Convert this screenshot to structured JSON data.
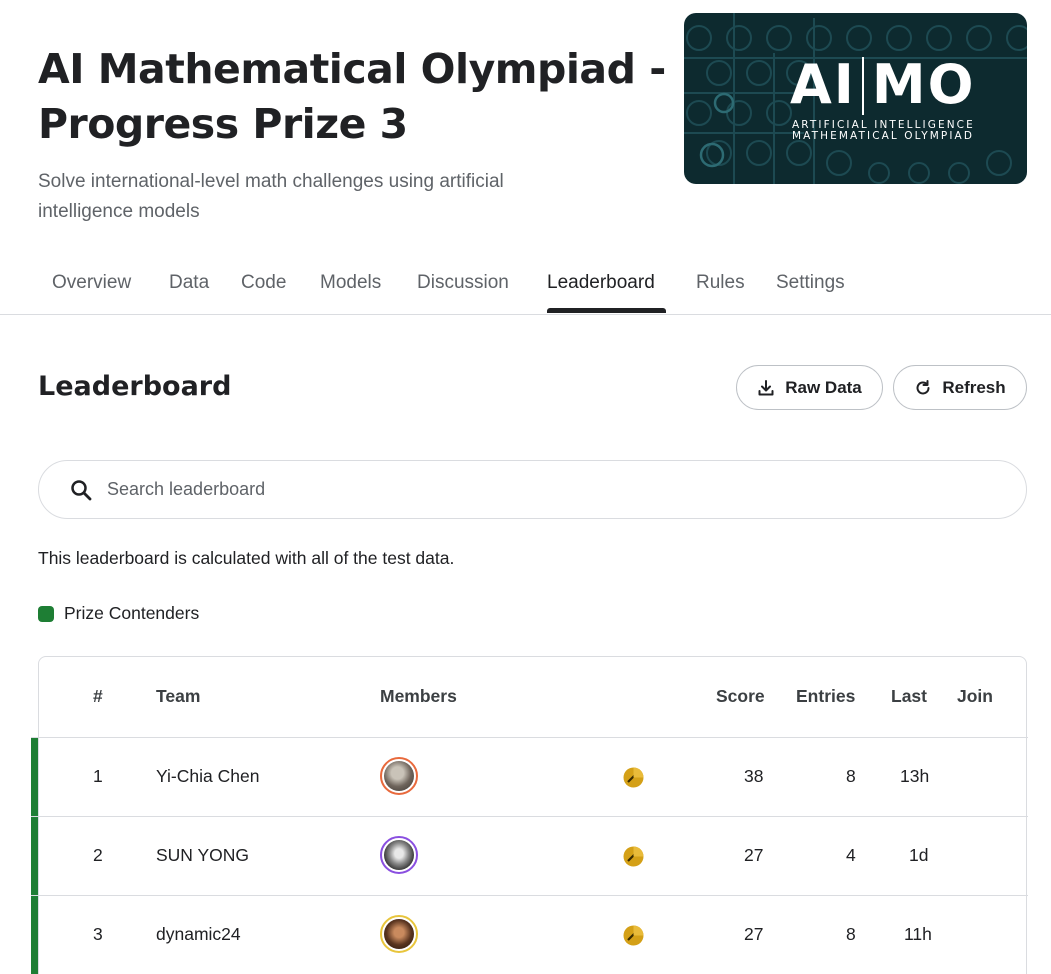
{
  "competition": {
    "title": "AI Mathematical Olympiad - Progress Prize 3",
    "subtitle": "Solve international-level math challenges using artificial intelligence models",
    "logo": {
      "main_left": "AI",
      "main_right": "MO",
      "sub_line1": "ARTIFICIAL INTELLIGENCE",
      "sub_line2": "MATHEMATICAL OLYMPIAD"
    }
  },
  "tabs": [
    {
      "label": "Overview"
    },
    {
      "label": "Data"
    },
    {
      "label": "Code"
    },
    {
      "label": "Models"
    },
    {
      "label": "Discussion"
    },
    {
      "label": "Leaderboard",
      "active": true
    },
    {
      "label": "Rules"
    },
    {
      "label": "Settings"
    }
  ],
  "leaderboard": {
    "title": "Leaderboard",
    "raw_data_label": "Raw Data",
    "refresh_label": "Refresh",
    "search_placeholder": "Search leaderboard",
    "note": "This leaderboard is calculated with all of the test data.",
    "legend_label": "Prize Contenders",
    "columns": {
      "rank": "#",
      "team": "Team",
      "members": "Members",
      "score": "Score",
      "entries": "Entries",
      "last": "Last",
      "join": "Join"
    },
    "rows": [
      {
        "rank": "1",
        "team": "Yi-Chia Chen",
        "score": "38",
        "entries": "8",
        "last": "13h",
        "avatar_ring": "#e8693c",
        "medal": "gold"
      },
      {
        "rank": "2",
        "team": "SUN YONG",
        "score": "27",
        "entries": "4",
        "last": "1d",
        "avatar_ring": "#8a4fe0",
        "medal": "gold"
      },
      {
        "rank": "3",
        "team": "dynamic24",
        "score": "27",
        "entries": "8",
        "last": "11h",
        "avatar_ring": "#e8c53c",
        "medal": "gold"
      }
    ]
  },
  "colors": {
    "prize_contender": "#1e7e34",
    "logo_bg": "#0d2a2f",
    "medal_gold": "#d4a017"
  }
}
